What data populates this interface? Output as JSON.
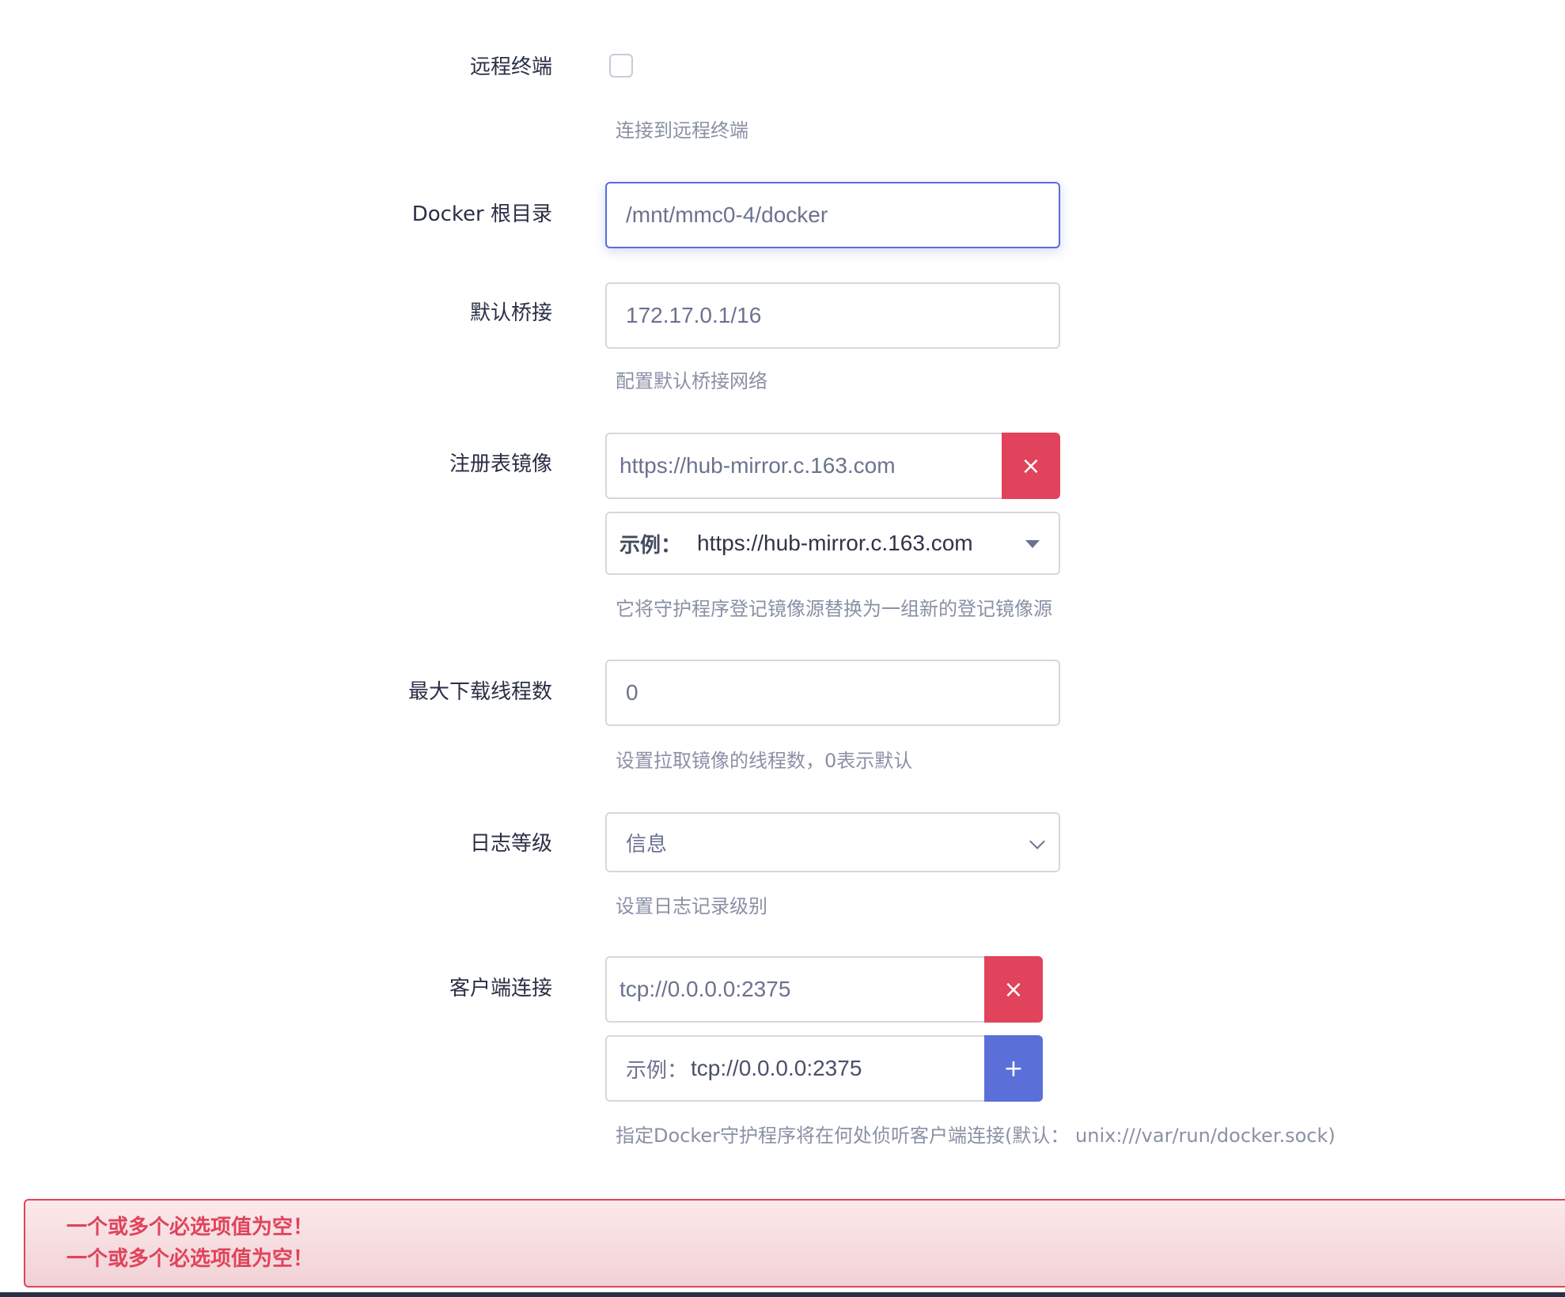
{
  "remote_terminal": {
    "label": "远程终端",
    "checked": false,
    "description": "连接到远程终端"
  },
  "docker_root": {
    "label": "Docker 根目录",
    "value": "/mnt/mmc0-4/docker"
  },
  "default_bridge": {
    "label": "默认桥接",
    "value": "172.17.0.1/16",
    "description": "配置默认桥接网络"
  },
  "registry_mirror": {
    "label": "注册表镜像",
    "value": "https://hub-mirror.c.163.com",
    "remove_icon": "×",
    "example_prefix": "示例：",
    "example_value": "https://hub-mirror.c.163.com",
    "description": "它将守护程序登记镜像源替换为一组新的登记镜像源"
  },
  "max_download_threads": {
    "label": "最大下载线程数",
    "value": "0",
    "description": "设置拉取镜像的线程数，0表示默认"
  },
  "log_level": {
    "label": "日志等级",
    "selected": "信息",
    "description": "设置日志记录级别"
  },
  "client_connection": {
    "label": "客户端连接",
    "value": "tcp://0.0.0.0:2375",
    "remove_icon": "×",
    "placeholder_prefix": "示例：",
    "placeholder_value": "tcp://0.0.0.0:2375",
    "add_icon": "+",
    "description": "指定Docker守护程序将在何处侦听客户端连接(默认：  unix:///var/run/docker.sock)"
  },
  "alert": {
    "lines": [
      "一个或多个必选项值为空！",
      "一个或多个必选项值为空！"
    ]
  },
  "colors": {
    "danger": "#e0435b",
    "primary": "#5a6fd8",
    "focus_border": "#5b6bdc"
  }
}
